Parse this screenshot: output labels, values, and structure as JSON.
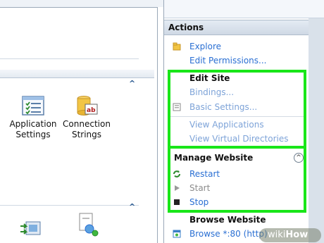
{
  "actions": {
    "title": "Actions",
    "explore": "Explore",
    "edit_permissions": "Edit Permissions...",
    "edit_site": {
      "title": "Edit Site",
      "bindings": "Bindings...",
      "basic_settings": "Basic Settings...",
      "view_applications": "View Applications",
      "view_virtual_directories": "View Virtual Directories"
    },
    "manage_website": {
      "title": "Manage Website",
      "restart": "Restart",
      "start": "Start",
      "stop": "Stop"
    },
    "browse_website": {
      "title": "Browse Website",
      "browse": "Browse *:80 (http)"
    }
  },
  "features": {
    "app_settings": "Application Settings",
    "app_settings_l1": "Application",
    "app_settings_l2": "Settings",
    "conn_strings_l1": "Connection",
    "conn_strings_l2": "Strings"
  },
  "watermark": {
    "prefix": "wiki",
    "suffix": "How"
  },
  "colors": {
    "highlight": "#19e619",
    "link": "#2a6fd3",
    "header": "#cfd9e5"
  }
}
